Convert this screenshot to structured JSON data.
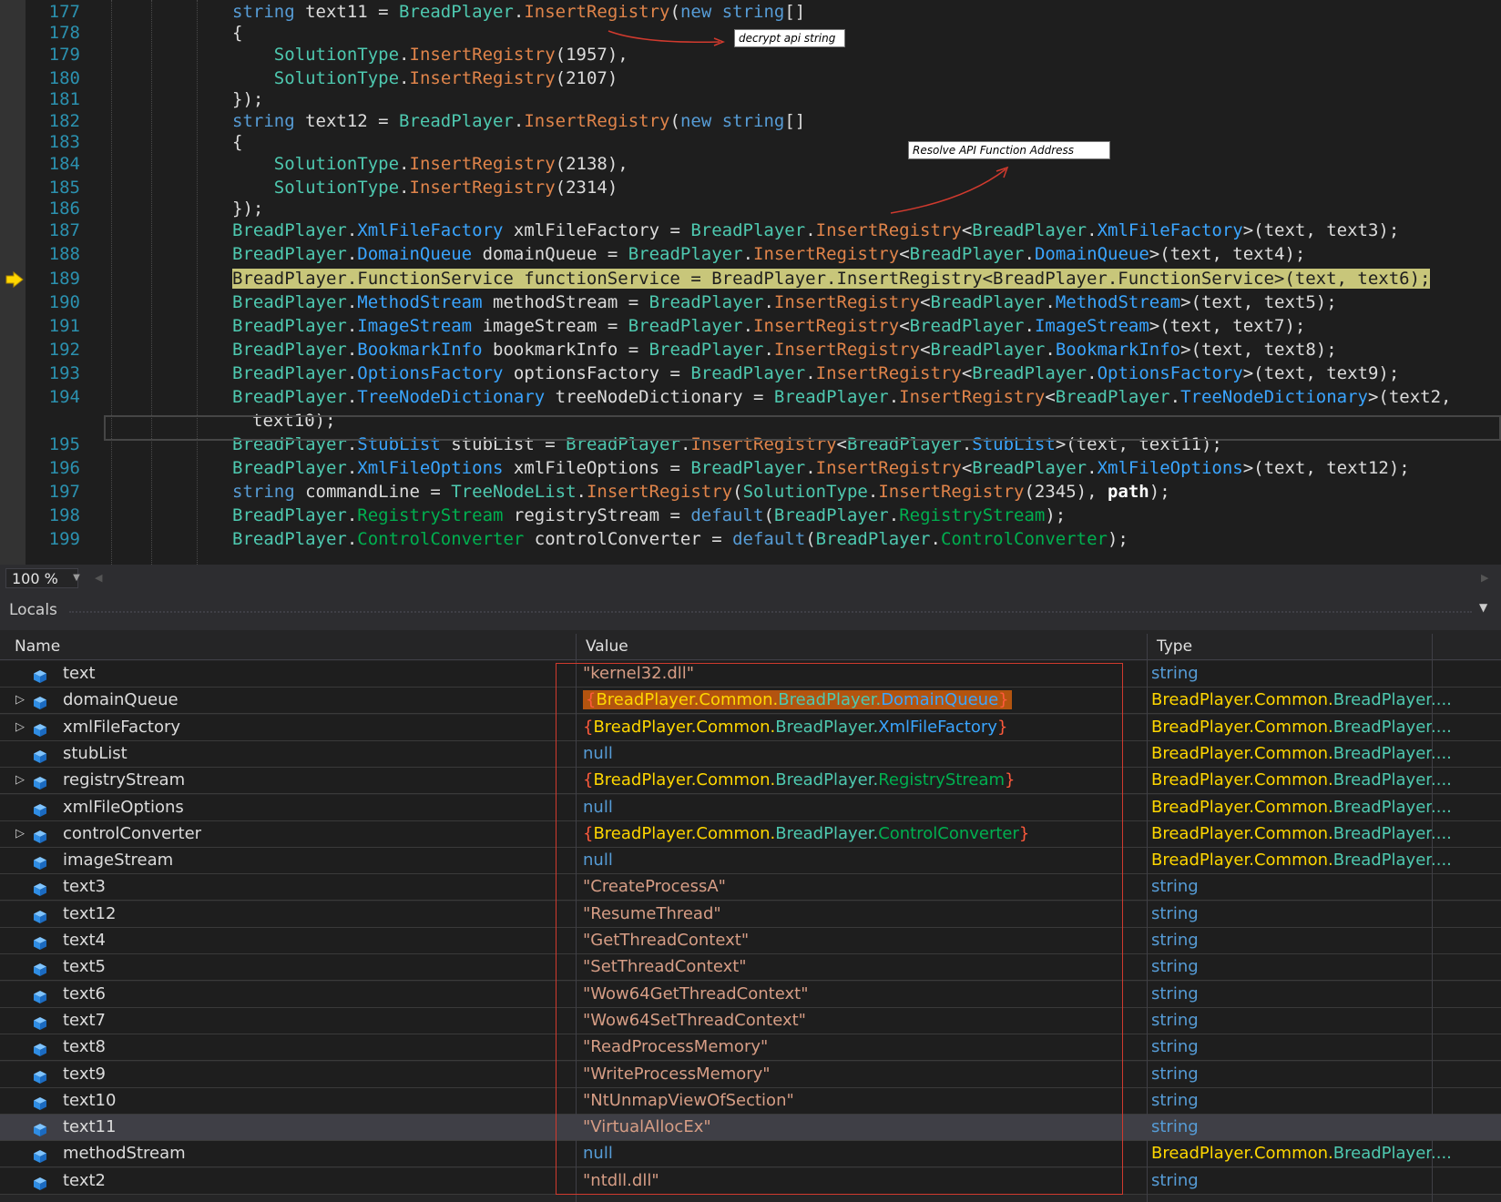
{
  "editor": {
    "lines": [
      {
        "n": "177",
        "cls": "",
        "html": "<span class='kw'>string</span> text11 = <span class='cls'>BreadPlayer</span>.<span class='mth'>InsertRegistry</span>(<span class='kw'>new</span> <span class='kw'>string</span>[]"
      },
      {
        "n": "178",
        "cls": "",
        "html": "{"
      },
      {
        "n": "179",
        "cls": "",
        "html": "    <span class='cls'>SolutionType</span>.<span class='mth'>InsertRegistry</span>(1957),"
      },
      {
        "n": "180",
        "cls": "",
        "html": "    <span class='cls'>SolutionType</span>.<span class='mth'>InsertRegistry</span>(2107)"
      },
      {
        "n": "181",
        "cls": "",
        "html": "});"
      },
      {
        "n": "182",
        "cls": "",
        "html": "<span class='kw'>string</span> text12 = <span class='cls'>BreadPlayer</span>.<span class='mth'>InsertRegistry</span>(<span class='kw'>new</span> <span class='kw'>string</span>[]"
      },
      {
        "n": "183",
        "cls": "",
        "html": "{"
      },
      {
        "n": "184",
        "cls": "",
        "html": "    <span class='cls'>SolutionType</span>.<span class='mth'>InsertRegistry</span>(2138),"
      },
      {
        "n": "185",
        "cls": "",
        "html": "    <span class='cls'>SolutionType</span>.<span class='mth'>InsertRegistry</span>(2314)"
      },
      {
        "n": "186",
        "cls": "",
        "html": "});"
      },
      {
        "n": "187",
        "cls": "",
        "html": "<span class='cls'>BreadPlayer</span>.<span class='ifc'>XmlFileFactory</span> xmlFileFactory = <span class='cls'>BreadPlayer</span>.<span class='mth'>InsertRegistry</span>&lt;<span class='cls'>BreadPlayer</span>.<span class='ifc'>XmlFileFactory</span>&gt;(text, text3);"
      },
      {
        "n": "188",
        "cls": "",
        "html": "<span class='cls'>BreadPlayer</span>.<span class='ifc'>DomainQueue</span> domainQueue = <span class='cls'>BreadPlayer</span>.<span class='mth'>InsertRegistry</span>&lt;<span class='cls'>BreadPlayer</span>.<span class='ifc'>DomainQueue</span>&gt;(text, text4);"
      },
      {
        "n": "189",
        "cls": "hl",
        "html": "BreadPlayer.FunctionService functionService = BreadPlayer.InsertRegistry&lt;BreadPlayer.FunctionService&gt;(text, text6);"
      },
      {
        "n": "190",
        "cls": "",
        "html": "<span class='cls'>BreadPlayer</span>.<span class='ifc'>MethodStream</span> methodStream = <span class='cls'>BreadPlayer</span>.<span class='mth'>InsertRegistry</span>&lt;<span class='cls'>BreadPlayer</span>.<span class='ifc'>MethodStream</span>&gt;(text, text5);"
      },
      {
        "n": "191",
        "cls": "",
        "html": "<span class='cls'>BreadPlayer</span>.<span class='ifc'>ImageStream</span> imageStream = <span class='cls'>BreadPlayer</span>.<span class='mth'>InsertRegistry</span>&lt;<span class='cls'>BreadPlayer</span>.<span class='ifc'>ImageStream</span>&gt;(text, text7);"
      },
      {
        "n": "192",
        "cls": "",
        "html": "<span class='cls'>BreadPlayer</span>.<span class='ifc'>BookmarkInfo</span> bookmarkInfo = <span class='cls'>BreadPlayer</span>.<span class='mth'>InsertRegistry</span>&lt;<span class='cls'>BreadPlayer</span>.<span class='ifc'>BookmarkInfo</span>&gt;(text, text8);"
      },
      {
        "n": "193",
        "cls": "",
        "html": "<span class='cls'>BreadPlayer</span>.<span class='ifc'>OptionsFactory</span> optionsFactory = <span class='cls'>BreadPlayer</span>.<span class='mth'>InsertRegistry</span>&lt;<span class='cls'>BreadPlayer</span>.<span class='ifc'>OptionsFactory</span>&gt;(text, text9);"
      },
      {
        "n": "194",
        "cls": "",
        "html": "<span class='cls'>BreadPlayer</span>.<span class='ifc'>TreeNodeDictionary</span> treeNodeDictionary = <span class='cls'>BreadPlayer</span>.<span class='mth'>InsertRegistry</span>&lt;<span class='cls'>BreadPlayer</span>.<span class='ifc'>TreeNodeDictionary</span>&gt;(text2,"
      },
      {
        "n": "",
        "cls": "cont",
        "html": "text10);"
      },
      {
        "n": "195",
        "cls": "",
        "html": "<span class='cls'>BreadPlayer</span>.<span class='ifc'>StubList</span> stubList = <span class='cls'>BreadPlayer</span>.<span class='mth'>InsertRegistry</span>&lt;<span class='cls'>BreadPlayer</span>.<span class='ifc'>StubList</span>&gt;(text, text11);"
      },
      {
        "n": "196",
        "cls": "",
        "html": "<span class='cls'>BreadPlayer</span>.<span class='ifc'>XmlFileOptions</span> xmlFileOptions = <span class='cls'>BreadPlayer</span>.<span class='mth'>InsertRegistry</span>&lt;<span class='cls'>BreadPlayer</span>.<span class='ifc'>XmlFileOptions</span>&gt;(text, text12);"
      },
      {
        "n": "197",
        "cls": "",
        "html": "<span class='kw'>string</span> commandLine = <span class='cls'>TreeNodeList</span>.<span class='mth'>InsertRegistry</span>(<span class='cls'>SolutionType</span>.<span class='mth'>InsertRegistry</span>(2345), <span class='bold'>path</span>);"
      },
      {
        "n": "198",
        "cls": "",
        "html": "<span class='cls'>BreadPlayer</span>.<span class='grn'>RegistryStream</span> registryStream = <span class='def'>default</span>(<span class='cls'>BreadPlayer</span>.<span class='grn'>RegistryStream</span>);"
      },
      {
        "n": "199",
        "cls": "",
        "html": "<span class='cls'>BreadPlayer</span>.<span class='grn'>ControlConverter</span> controlConverter = <span class='def'>default</span>(<span class='cls'>BreadPlayer</span>.<span class='grn'>ControlConverter</span>);"
      }
    ],
    "annotation_decrypt": "decrypt api string",
    "annotation_resolve": "Resolve API Function Address"
  },
  "zoom": {
    "value": "100 %"
  },
  "locals": {
    "title": "Locals",
    "columns": {
      "name": "Name",
      "value": "Value",
      "type": "Type"
    },
    "rows": [
      {
        "name": "text",
        "expand": false,
        "value": "\"kernel32.dll\"",
        "vkind": "str",
        "type": "string",
        "tkind": "str"
      },
      {
        "name": "domainQueue",
        "expand": true,
        "value_parts": [
          [
            "{",
            "t-red"
          ],
          [
            "BreadPlayer.Common.",
            "t-yel"
          ],
          [
            "BreadPlayer.",
            "t-cls"
          ],
          [
            "DomainQueue",
            "t-ifc"
          ],
          [
            "}",
            "t-red"
          ]
        ],
        "hl": true,
        "type": "BreadPlayer.Common.BreadPlayer....",
        "tkind": "obj"
      },
      {
        "name": "xmlFileFactory",
        "expand": true,
        "value_parts": [
          [
            "{",
            "t-red"
          ],
          [
            "BreadPlayer.Common.",
            "t-yel"
          ],
          [
            "BreadPlayer.",
            "t-cls"
          ],
          [
            "XmlFileFactory",
            "t-ifc"
          ],
          [
            "}",
            "t-red"
          ]
        ],
        "type": "BreadPlayer.Common.BreadPlayer....",
        "tkind": "obj"
      },
      {
        "name": "stubList",
        "expand": false,
        "value": "null",
        "vkind": "null",
        "type": "BreadPlayer.Common.BreadPlayer....",
        "tkind": "obj"
      },
      {
        "name": "registryStream",
        "expand": true,
        "value_parts": [
          [
            "{",
            "t-red"
          ],
          [
            "BreadPlayer.Common.",
            "t-yel"
          ],
          [
            "BreadPlayer.",
            "t-cls"
          ],
          [
            "RegistryStream",
            "t-grn"
          ],
          [
            "}",
            "t-red"
          ]
        ],
        "type": "BreadPlayer.Common.BreadPlayer....",
        "tkind": "obj"
      },
      {
        "name": "xmlFileOptions",
        "expand": false,
        "value": "null",
        "vkind": "null",
        "type": "BreadPlayer.Common.BreadPlayer....",
        "tkind": "obj"
      },
      {
        "name": "controlConverter",
        "expand": true,
        "value_parts": [
          [
            "{",
            "t-red"
          ],
          [
            "BreadPlayer.Common.",
            "t-yel"
          ],
          [
            "BreadPlayer.",
            "t-cls"
          ],
          [
            "ControlConverter",
            "t-grn"
          ],
          [
            "}",
            "t-red"
          ]
        ],
        "type": "BreadPlayer.Common.BreadPlayer....",
        "tkind": "obj"
      },
      {
        "name": "imageStream",
        "expand": false,
        "value": "null",
        "vkind": "null",
        "type": "BreadPlayer.Common.BreadPlayer....",
        "tkind": "obj"
      },
      {
        "name": "text3",
        "expand": false,
        "value": "\"CreateProcessA\"",
        "vkind": "str",
        "type": "string",
        "tkind": "str"
      },
      {
        "name": "text12",
        "expand": false,
        "value": "\"ResumeThread\"",
        "vkind": "str",
        "type": "string",
        "tkind": "str"
      },
      {
        "name": "text4",
        "expand": false,
        "value": "\"GetThreadContext\"",
        "vkind": "str",
        "type": "string",
        "tkind": "str"
      },
      {
        "name": "text5",
        "expand": false,
        "value": "\"SetThreadContext\"",
        "vkind": "str",
        "type": "string",
        "tkind": "str"
      },
      {
        "name": "text6",
        "expand": false,
        "value": "\"Wow64GetThreadContext\"",
        "vkind": "str",
        "type": "string",
        "tkind": "str"
      },
      {
        "name": "text7",
        "expand": false,
        "value": "\"Wow64SetThreadContext\"",
        "vkind": "str",
        "type": "string",
        "tkind": "str"
      },
      {
        "name": "text8",
        "expand": false,
        "value": "\"ReadProcessMemory\"",
        "vkind": "str",
        "type": "string",
        "tkind": "str"
      },
      {
        "name": "text9",
        "expand": false,
        "value": "\"WriteProcessMemory\"",
        "vkind": "str",
        "type": "string",
        "tkind": "str"
      },
      {
        "name": "text10",
        "expand": false,
        "value": "\"NtUnmapViewOfSection\"",
        "vkind": "str",
        "type": "string",
        "tkind": "str"
      },
      {
        "name": "text11",
        "expand": false,
        "value": "\"VirtualAllocEx\"",
        "vkind": "str",
        "type": "string",
        "tkind": "str",
        "selected": true
      },
      {
        "name": "methodStream",
        "expand": false,
        "value": "null",
        "vkind": "null",
        "type": "BreadPlayer.Common.BreadPlayer....",
        "tkind": "obj"
      },
      {
        "name": "text2",
        "expand": false,
        "value": "\"ntdll.dll\"",
        "vkind": "str",
        "type": "string",
        "tkind": "str"
      }
    ]
  },
  "colors": {
    "accent_highlight": "#c8c67a",
    "annotation_border": "#d03a2e",
    "value_highlight": "#b3540f"
  }
}
